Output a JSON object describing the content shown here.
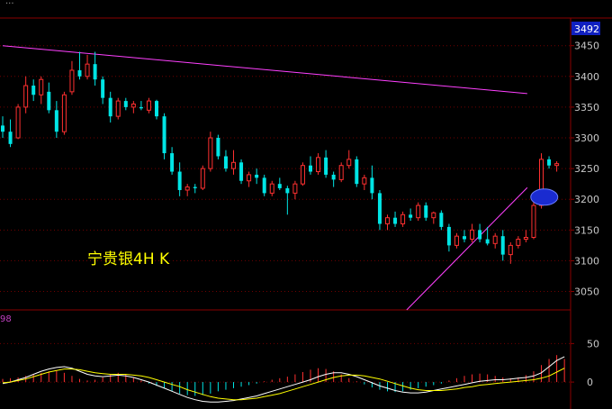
{
  "header": {
    "text": "..."
  },
  "chart_data": [
    {
      "type": "candlestick",
      "title": "宁贵银4H K",
      "current_price_label": "3492",
      "ylim": [
        3020,
        3495
      ],
      "yticks": [
        "3450",
        "3400",
        "3350",
        "3300",
        "3250",
        "3200",
        "3150",
        "3100",
        "3050"
      ],
      "colors": {
        "up": "#ff3030",
        "down": "#00e5e5",
        "trendline": "#ff40ff",
        "grid": "#700000",
        "highlight": "#1a2bd0"
      },
      "trendlines": [
        {
          "name": "resistance",
          "from": {
            "i": 0,
            "price": 3450
          },
          "to": {
            "i": 67,
            "price": 3372
          }
        },
        {
          "name": "support",
          "from": {
            "i": 52.5,
            "price": 3020
          },
          "to": {
            "i": 67,
            "price": 3219
          }
        }
      ],
      "highlight": {
        "i": 65,
        "price": 3205
      },
      "ohlc": [
        [
          3320,
          3335,
          3300,
          3310
        ],
        [
          3310,
          3330,
          3285,
          3290
        ],
        [
          3300,
          3355,
          3298,
          3350
        ],
        [
          3350,
          3400,
          3340,
          3385
        ],
        [
          3385,
          3395,
          3360,
          3370
        ],
        [
          3370,
          3400,
          3355,
          3395
        ],
        [
          3375,
          3390,
          3340,
          3345
        ],
        [
          3345,
          3360,
          3300,
          3310
        ],
        [
          3310,
          3375,
          3305,
          3370
        ],
        [
          3375,
          3425,
          3370,
          3410
        ],
        [
          3410,
          3440,
          3395,
          3400
        ],
        [
          3400,
          3435,
          3395,
          3420
        ],
        [
          3420,
          3440,
          3385,
          3395
        ],
        [
          3395,
          3400,
          3355,
          3365
        ],
        [
          3365,
          3375,
          3325,
          3335
        ],
        [
          3335,
          3365,
          3330,
          3360
        ],
        [
          3360,
          3365,
          3345,
          3350
        ],
        [
          3350,
          3360,
          3340,
          3355
        ],
        [
          3350,
          3360,
          3345,
          3348
        ],
        [
          3345,
          3365,
          3340,
          3360
        ],
        [
          3360,
          3362,
          3330,
          3335
        ],
        [
          3335,
          3340,
          3265,
          3275
        ],
        [
          3275,
          3285,
          3240,
          3245
        ],
        [
          3245,
          3260,
          3205,
          3215
        ],
        [
          3215,
          3225,
          3205,
          3220
        ],
        [
          3220,
          3225,
          3210,
          3218
        ],
        [
          3218,
          3255,
          3215,
          3250
        ],
        [
          3250,
          3310,
          3245,
          3300
        ],
        [
          3300,
          3305,
          3265,
          3270
        ],
        [
          3270,
          3280,
          3245,
          3250
        ],
        [
          3250,
          3280,
          3240,
          3260
        ],
        [
          3260,
          3265,
          3225,
          3230
        ],
        [
          3230,
          3245,
          3220,
          3240
        ],
        [
          3240,
          3250,
          3225,
          3235
        ],
        [
          3235,
          3240,
          3205,
          3210
        ],
        [
          3210,
          3230,
          3205,
          3225
        ],
        [
          3225,
          3235,
          3215,
          3218
        ],
        [
          3218,
          3222,
          3175,
          3210
        ],
        [
          3210,
          3230,
          3200,
          3225
        ],
        [
          3225,
          3260,
          3222,
          3255
        ],
        [
          3255,
          3270,
          3240,
          3245
        ],
        [
          3245,
          3275,
          3240,
          3268
        ],
        [
          3268,
          3280,
          3235,
          3240
        ],
        [
          3240,
          3245,
          3220,
          3232
        ],
        [
          3232,
          3260,
          3228,
          3255
        ],
        [
          3255,
          3280,
          3250,
          3265
        ],
        [
          3265,
          3270,
          3220,
          3225
        ],
        [
          3225,
          3240,
          3215,
          3235
        ],
        [
          3235,
          3255,
          3200,
          3210
        ],
        [
          3210,
          3215,
          3150,
          3160
        ],
        [
          3160,
          3175,
          3150,
          3170
        ],
        [
          3170,
          3180,
          3155,
          3160
        ],
        [
          3160,
          3180,
          3155,
          3175
        ],
        [
          3175,
          3185,
          3165,
          3170
        ],
        [
          3170,
          3195,
          3165,
          3190
        ],
        [
          3190,
          3195,
          3165,
          3170
        ],
        [
          3170,
          3180,
          3160,
          3178
        ],
        [
          3178,
          3182,
          3150,
          3155
        ],
        [
          3155,
          3160,
          3115,
          3125
        ],
        [
          3125,
          3145,
          3120,
          3140
        ],
        [
          3140,
          3150,
          3130,
          3135
        ],
        [
          3135,
          3160,
          3130,
          3150
        ],
        [
          3150,
          3160,
          3130,
          3135
        ],
        [
          3135,
          3155,
          3125,
          3128
        ],
        [
          3128,
          3145,
          3120,
          3140
        ],
        [
          3140,
          3150,
          3100,
          3110
        ],
        [
          3110,
          3130,
          3095,
          3125
        ],
        [
          3125,
          3140,
          3120,
          3135
        ],
        [
          3135,
          3150,
          3130,
          3138
        ],
        [
          3138,
          3200,
          3135,
          3190
        ],
        [
          3190,
          3275,
          3185,
          3265
        ],
        [
          3265,
          3270,
          3250,
          3255
        ],
        [
          3255,
          3262,
          3245,
          3258
        ]
      ]
    },
    {
      "type": "macd",
      "indicator_label": "98",
      "ylim": [
        -35,
        75
      ],
      "yticks": [
        "50",
        "0"
      ],
      "colors": {
        "hist_up": "#ff3030",
        "hist_down": "#00e5e5",
        "dif": "#ffffff",
        "dea": "#ffff00"
      },
      "histogram": [
        4,
        5,
        6,
        8,
        10,
        12,
        14,
        15,
        12,
        8,
        4,
        2,
        3,
        6,
        10,
        12,
        10,
        6,
        2,
        -2,
        -5,
        -8,
        -12,
        -15,
        -17,
        -18,
        -17,
        -15,
        -12,
        -10,
        -8,
        -6,
        -4,
        -2,
        1,
        3,
        5,
        7,
        10,
        13,
        16,
        18,
        17,
        14,
        10,
        5,
        1,
        -3,
        -7,
        -10,
        -12,
        -13,
        -12,
        -10,
        -8,
        -6,
        -4,
        -2,
        2,
        5,
        8,
        10,
        11,
        10,
        8,
        6,
        5,
        6,
        9,
        14,
        22,
        30,
        35,
        30
      ],
      "dif": [
        -2,
        0,
        3,
        6,
        10,
        14,
        17,
        19,
        20,
        18,
        14,
        10,
        8,
        7,
        8,
        9,
        8,
        6,
        3,
        0,
        -4,
        -8,
        -12,
        -16,
        -20,
        -23,
        -25,
        -26,
        -26,
        -25,
        -24,
        -22,
        -20,
        -18,
        -15,
        -12,
        -9,
        -6,
        -3,
        0,
        3,
        7,
        10,
        12,
        12,
        10,
        7,
        3,
        -1,
        -5,
        -8,
        -11,
        -13,
        -14,
        -14,
        -13,
        -11,
        -9,
        -7,
        -5,
        -3,
        -1,
        1,
        2,
        3,
        3,
        4,
        5,
        6,
        8,
        12,
        20,
        28,
        33
      ],
      "dea": [
        -1,
        0,
        2,
        4,
        7,
        10,
        13,
        15,
        17,
        17,
        16,
        14,
        12,
        11,
        10,
        10,
        10,
        9,
        8,
        6,
        3,
        0,
        -3,
        -6,
        -10,
        -13,
        -16,
        -19,
        -21,
        -22,
        -23,
        -23,
        -22,
        -21,
        -19,
        -17,
        -15,
        -12,
        -9,
        -6,
        -3,
        0,
        3,
        6,
        8,
        9,
        9,
        8,
        6,
        4,
        1,
        -2,
        -5,
        -8,
        -10,
        -11,
        -11,
        -11,
        -10,
        -9,
        -7,
        -6,
        -4,
        -3,
        -2,
        -1,
        0,
        1,
        2,
        3,
        5,
        8,
        13,
        18
      ]
    }
  ]
}
